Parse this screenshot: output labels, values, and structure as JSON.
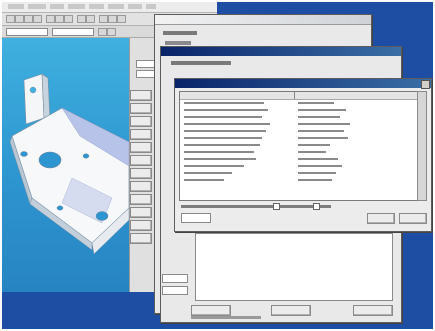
{
  "cad_window": {
    "menu_items": [
      "",
      "",
      "",
      "",
      "",
      "",
      "",
      ""
    ],
    "toolbar_icons": [
      "new-icon",
      "open-icon",
      "save-icon",
      "print-icon",
      "cut-icon",
      "copy-icon",
      "paste-icon",
      "undo-icon",
      "redo-icon",
      "zoom-icon",
      "rotate-icon",
      "pan-icon"
    ],
    "part_color": "#ffffff",
    "viewport_color": "#39a8d8"
  },
  "dialog_back": {
    "title": "",
    "nav_labels": [
      "",
      "",
      "",
      "",
      "",
      "",
      "",
      "",
      "",
      "",
      "",
      ""
    ]
  },
  "dialog_mid": {
    "title": "",
    "bottom_buttons": [
      "",
      "",
      ""
    ],
    "status_text": ""
  },
  "dialog_front": {
    "title": "",
    "columns": [
      "",
      ""
    ],
    "rows": [
      {
        "code": "",
        "desc": ""
      },
      {
        "code": "",
        "desc": ""
      },
      {
        "code": "",
        "desc": ""
      },
      {
        "code": "",
        "desc": ""
      },
      {
        "code": "",
        "desc": ""
      },
      {
        "code": "",
        "desc": ""
      },
      {
        "code": "",
        "desc": ""
      },
      {
        "code": "",
        "desc": ""
      },
      {
        "code": "",
        "desc": ""
      },
      {
        "code": "",
        "desc": ""
      },
      {
        "code": "",
        "desc": ""
      },
      {
        "code": "",
        "desc": ""
      },
      {
        "code": "",
        "desc": ""
      },
      {
        "code": "",
        "desc": ""
      }
    ],
    "options_text": "",
    "ok_label": "",
    "cancel_label": ""
  },
  "colors": {
    "desktop": "#1e4ea3",
    "titlebar_active": "#0a246a",
    "dialog_bg": "#e9e9e9",
    "list_bg": "#ffffff"
  }
}
